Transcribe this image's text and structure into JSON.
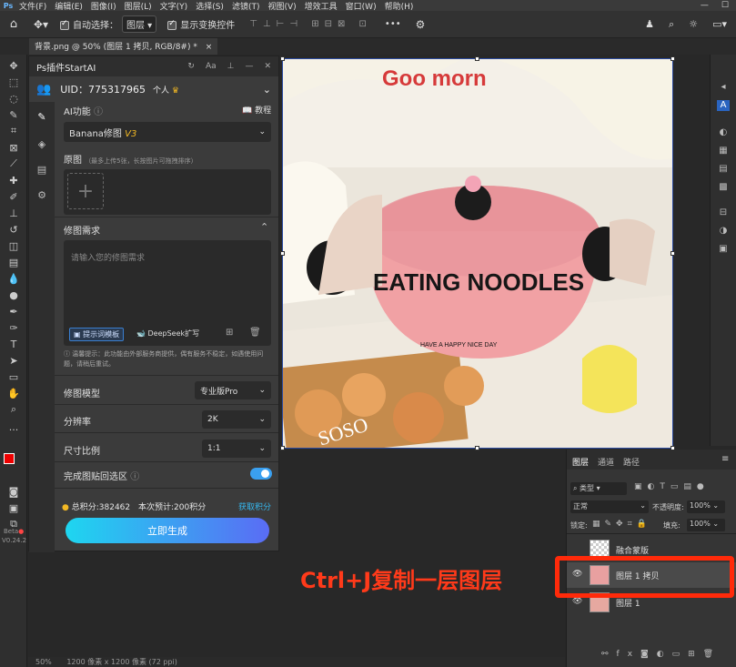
{
  "menubar": {
    "logo": "Ps",
    "items": [
      "文件(F)",
      "编辑(E)",
      "图像(I)",
      "图层(L)",
      "文字(Y)",
      "选择(S)",
      "滤镜(T)",
      "视图(V)",
      "增效工具",
      "窗口(W)",
      "帮助(H)"
    ]
  },
  "optbar": {
    "auto_select": "自动选择：",
    "auto_select_value": "图层",
    "show_transform": "显示变换控件",
    "more": "•••"
  },
  "doc_tab": {
    "title": "背景.png @ 50% (图层 1 拷贝, RGB/8#) *",
    "close": "×"
  },
  "plugin": {
    "title": "Ps插件StartAI",
    "uid": "UID：775317965",
    "account_type": "个人",
    "ai_function_label": "AI功能",
    "tutorial_label": "教程",
    "model_select": "Banana修图",
    "model_version": "V3",
    "source_label": "原图",
    "source_hint": "（最多上传5张，长按图片可拖拽排序）",
    "requirement_title": "修图需求",
    "requirement_placeholder": "请输入您的修图需求",
    "prompt_template_button": "提示词模板",
    "deepseek_button": "DeepSeek扩写",
    "notice": "温馨提示：此功能由外部服务商提供，偶有服务不稳定，如遇使用问题，请稍后重试。",
    "model_label": "修图模型",
    "model_value": "专业版Pro",
    "resolution_label": "分辨率",
    "resolution_value": "2K",
    "ratio_label": "尺寸比例",
    "ratio_value": "1:1",
    "paste_back_label": "完成图贴回选区",
    "paste_back_enabled": true,
    "points_total": "总积分:382462",
    "points_estimate": "本次预计:200积分",
    "get_points": "获取积分",
    "generate_button": "立即生成",
    "beta_label": "Beta",
    "version_label": "V0.24.2"
  },
  "canvas": {
    "cup_text_main": "EATING NOODLES",
    "cup_text_sub": "HAVE A HAPPY NICE DAY",
    "top_text": "Goo morn",
    "box_text": "SOSO"
  },
  "layers_panel": {
    "tabs": [
      "图层",
      "通道",
      "路径"
    ],
    "filter_label": "类型",
    "blend_mode": "正常",
    "opacity_label": "不透明度:",
    "opacity_value": "100%",
    "lock_label": "锁定:",
    "fill_label": "填充:",
    "fill_value": "100%",
    "layers": [
      {
        "name": "融合蒙版",
        "visible": false
      },
      {
        "name": "图层 1 拷贝",
        "visible": true,
        "selected": true
      },
      {
        "name": "图层 1",
        "visible": true
      }
    ]
  },
  "status": {
    "zoom": "50%",
    "doc_info": "1200 像素 x 1200 像素 (72 ppi)"
  },
  "overlay_caption": "Ctrl+J复制一层图层",
  "colors": {
    "accent_gradient_start": "#1ed6f0",
    "accent_gradient_end": "#5a6cf4",
    "highlight_red": "#ff2a0a",
    "toggle_blue": "#3aa0f0",
    "points_gold": "#f2b824"
  }
}
